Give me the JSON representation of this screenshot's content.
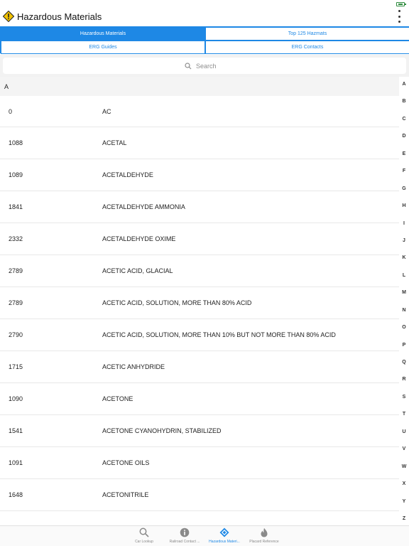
{
  "app": {
    "title": "Hazardous Materials"
  },
  "tabs": [
    {
      "label": "Hazardous Materials",
      "active": true
    },
    {
      "label": "Top 125 Hazmats",
      "active": false
    },
    {
      "label": "ERG Guides",
      "active": false
    },
    {
      "label": "ERG Contacts",
      "active": false
    }
  ],
  "search": {
    "placeholder": "Search"
  },
  "section": {
    "letter": "A"
  },
  "rows": [
    {
      "un": "0",
      "name": "AC"
    },
    {
      "un": "1088",
      "name": "ACETAL"
    },
    {
      "un": "1089",
      "name": "ACETALDEHYDE"
    },
    {
      "un": "1841",
      "name": "ACETALDEHYDE AMMONIA"
    },
    {
      "un": "2332",
      "name": "ACETALDEHYDE OXIME"
    },
    {
      "un": "2789",
      "name": "ACETIC ACID, GLACIAL"
    },
    {
      "un": "2789",
      "name": "ACETIC ACID, SOLUTION, MORE THAN 80% ACID"
    },
    {
      "un": "2790",
      "name": "ACETIC ACID, SOLUTION, MORE THAN 10% BUT NOT MORE THAN 80% ACID"
    },
    {
      "un": "1715",
      "name": "ACETIC ANHYDRIDE"
    },
    {
      "un": "1090",
      "name": "ACETONE"
    },
    {
      "un": "1541",
      "name": "ACETONE CYANOHYDRIN, STABILIZED"
    },
    {
      "un": "1091",
      "name": "ACETONE OILS"
    },
    {
      "un": "1648",
      "name": "ACETONITRILE"
    }
  ],
  "index_letters": [
    "A",
    "B",
    "C",
    "D",
    "E",
    "F",
    "G",
    "H",
    "I",
    "J",
    "K",
    "L",
    "M",
    "N",
    "O",
    "P",
    "Q",
    "R",
    "S",
    "T",
    "U",
    "V",
    "W",
    "X",
    "Y",
    "Z"
  ],
  "bottom_nav": [
    {
      "label": "Car Lookup",
      "icon": "search-icon",
      "active": false
    },
    {
      "label": "Railroad Contact ...",
      "icon": "info-icon",
      "active": false
    },
    {
      "label": "Hazardous Materi...",
      "icon": "hazmat-diamond-icon",
      "active": true
    },
    {
      "label": "Placard Reference",
      "icon": "flame-icon",
      "active": false
    }
  ],
  "colors": {
    "accent": "#1e88e5",
    "logo_yellow": "#f2c200",
    "battery": "#2e8b3e"
  }
}
